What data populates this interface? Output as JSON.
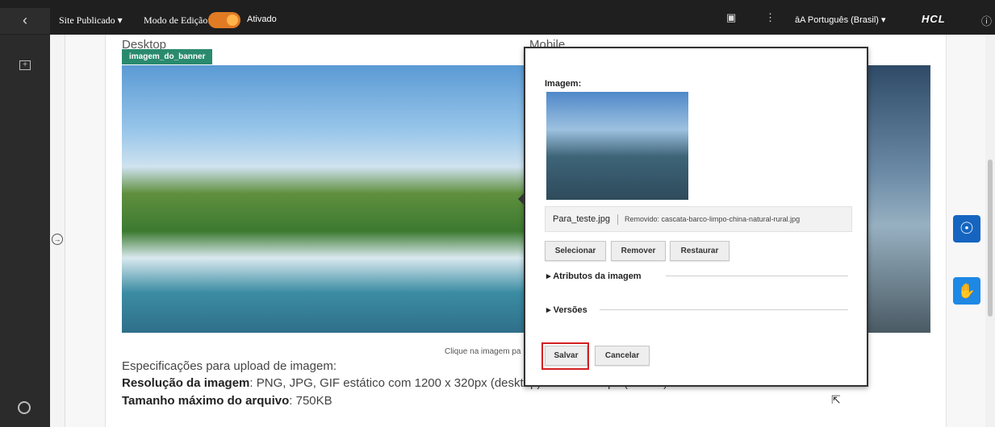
{
  "topbar": {
    "back_icon": "chevron-left-icon",
    "site_label": "Site Publicado",
    "edit_mode_label": "Modo de Edição:",
    "edit_mode_status": "Ativado",
    "toggle_color": "#e07b24",
    "language": "Português (Brasil)",
    "brand": "HCL"
  },
  "main": {
    "desktop_label": "Desktop",
    "mobile_label": "Mobile",
    "banner_tag": "imagem_do_banner",
    "caption": "Clique na imagem pa",
    "spec_title": "Especificações para upload de imagem:",
    "spec_resolution_label": "Resolução da imagem",
    "spec_resolution_value": ": PNG, JPG, GIF estático com 1200 x 320px (desktop) e 900 x 320px (mobile)",
    "spec_size_label": "Tamanho máximo do arquivo",
    "spec_size_value": ": 750KB"
  },
  "dialog": {
    "image_label": "Imagem:",
    "file_name": "Para_teste.jpg",
    "removed_text": "Removido: cascata-barco-limpo-china-natural-rural.jpg",
    "buttons": {
      "select": "Selecionar",
      "remove": "Remover",
      "restore": "Restaurar",
      "save": "Salvar",
      "cancel": "Cancelar"
    },
    "section_attributes": "Atributos da imagem",
    "section_versions": "Versões"
  },
  "colors": {
    "tag_bg": "#2a8a6d",
    "highlight": "#d21f1f",
    "accessibility_blue": "#1565c0"
  }
}
